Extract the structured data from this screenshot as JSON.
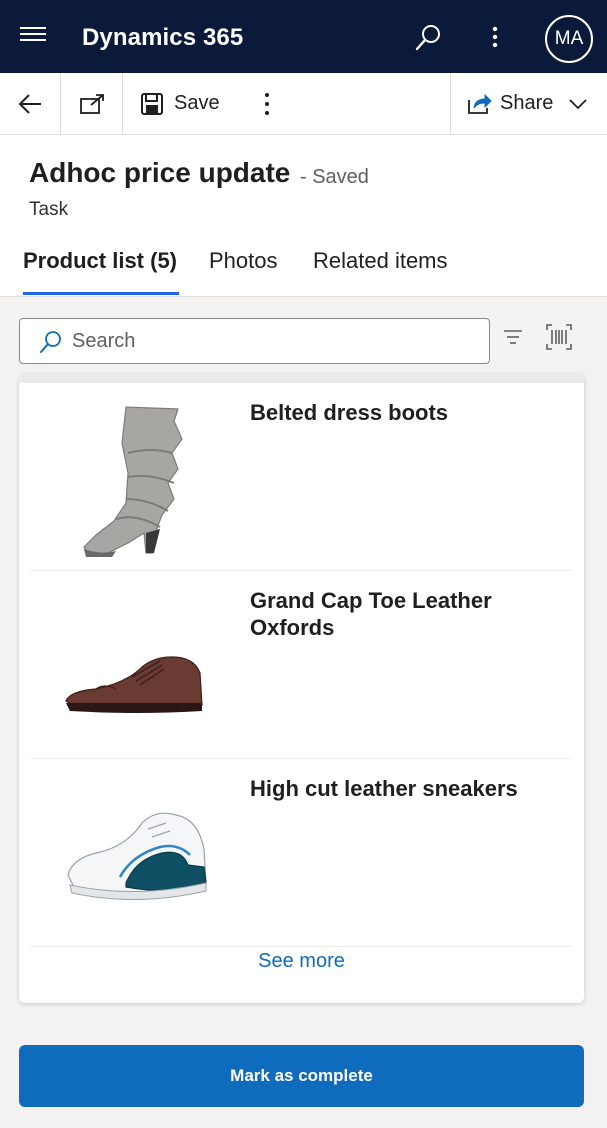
{
  "topbar": {
    "app_title": "Dynamics 365",
    "avatar_initials": "MA",
    "background": "#0b1a3b"
  },
  "commandbar": {
    "save_label": "Save",
    "share_label": "Share"
  },
  "record": {
    "title": "Adhoc price update",
    "status": "- Saved",
    "type": "Task"
  },
  "tabs": [
    {
      "label": "Product list (5)",
      "selected": true
    },
    {
      "label": "Photos",
      "selected": false
    },
    {
      "label": "Related items",
      "selected": false
    }
  ],
  "search": {
    "placeholder": "Search",
    "value": ""
  },
  "products": [
    {
      "name": "Belted dress boots",
      "image": "boot-image"
    },
    {
      "name": "Grand Cap Toe Leather Oxfords",
      "image": "oxford-shoe-image"
    },
    {
      "name": "High cut leather sneakers",
      "image": "sneaker-image"
    }
  ],
  "see_more_label": "See more",
  "complete_button_label": "Mark as complete",
  "colors": {
    "accent": "#0f6cbd",
    "tab_underline": "#2266e3"
  },
  "icons": [
    "hamburger-icon",
    "search-icon",
    "more-vertical-icon",
    "back-arrow-icon",
    "popout-icon",
    "save-disk-icon",
    "share-icon",
    "chevron-down-icon",
    "filter-icon",
    "barcode-scan-icon"
  ]
}
